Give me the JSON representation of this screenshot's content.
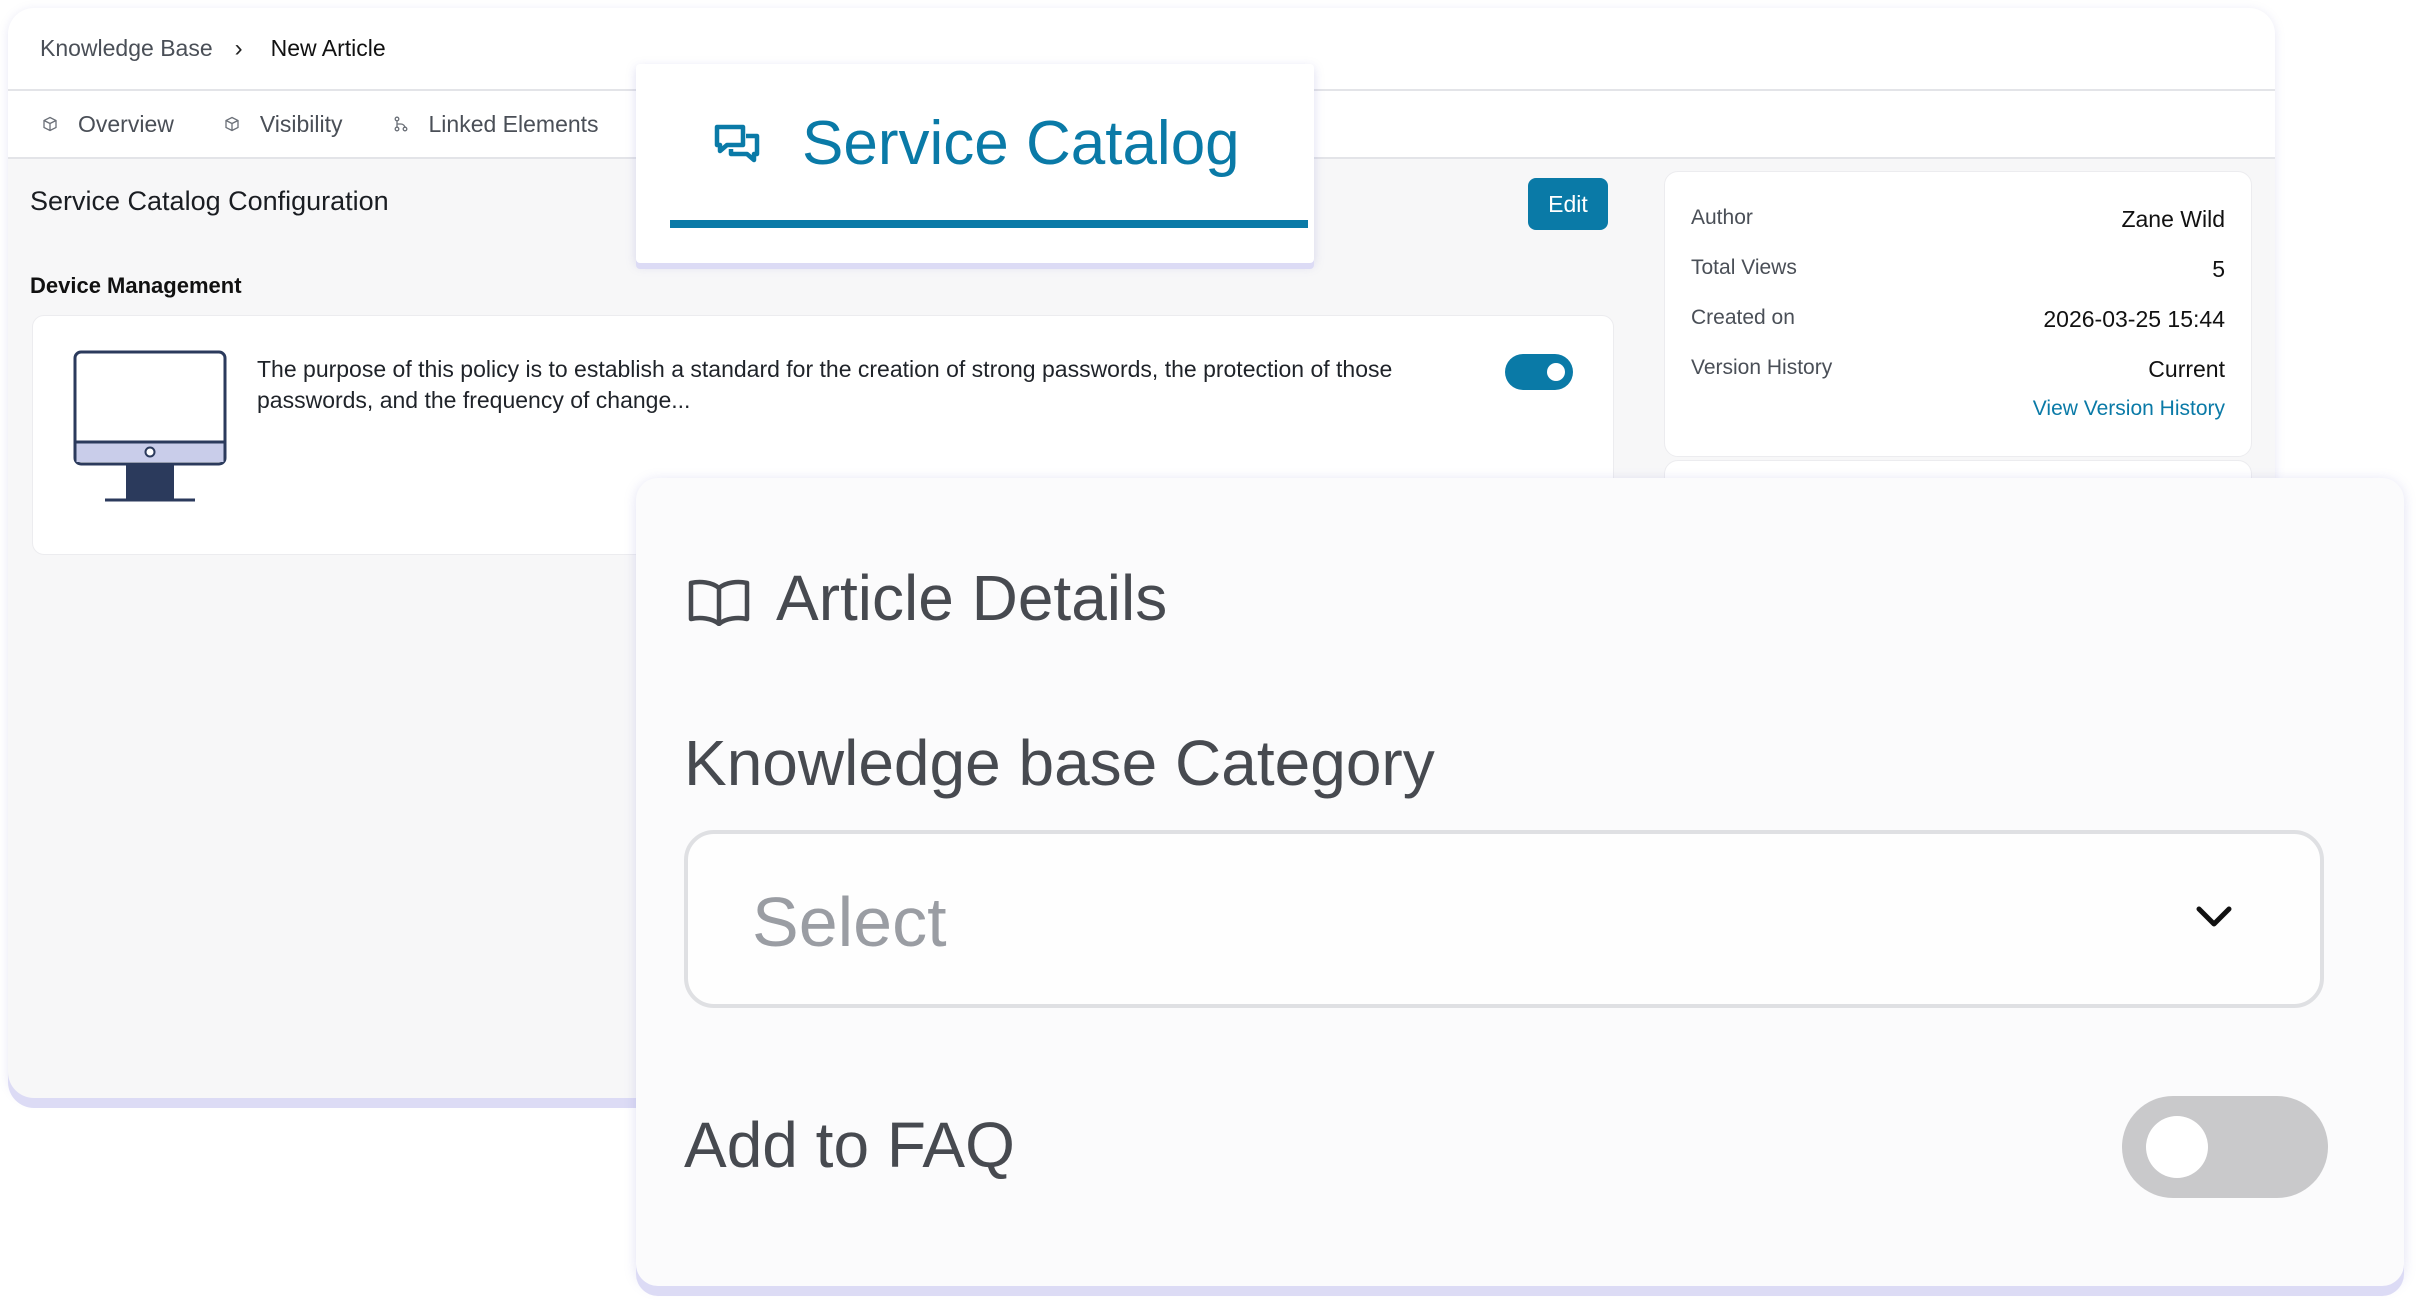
{
  "breadcrumb": {
    "home": "Knowledge Base",
    "separator": "›",
    "current": "New Article"
  },
  "tabs": [
    {
      "label": "Overview",
      "icon": "cube-icon"
    },
    {
      "label": "Visibility",
      "icon": "cube-icon"
    },
    {
      "label": "Linked Elements",
      "icon": "link-branch-icon"
    }
  ],
  "catalog": {
    "title": "Service Catalog",
    "icon": "chat-bubbles-icon",
    "accent": "#0a7aa7"
  },
  "config": {
    "title": "Service Catalog Configuration",
    "edit_label": "Edit",
    "section": "Device Management",
    "device": {
      "icon": "monitor-icon",
      "description": "The purpose of this policy is to establish a standard for the creation of strong passwords, the protection of those passwords, and the frequency of change...",
      "enabled": true
    }
  },
  "info": {
    "author_label": "Author",
    "author": "Zane Wild",
    "views_label": "Total Views",
    "views": "5",
    "created_label": "Created on",
    "created": "2026-03-25 15:44",
    "version_label": "Version History",
    "version": "Current",
    "version_link": "View Version History"
  },
  "details": {
    "title": "Article Details",
    "icon": "open-book-icon",
    "category_label": "Knowledge base Category",
    "category_placeholder": "Select",
    "faq_label": "Add to FAQ",
    "faq_enabled": false
  }
}
